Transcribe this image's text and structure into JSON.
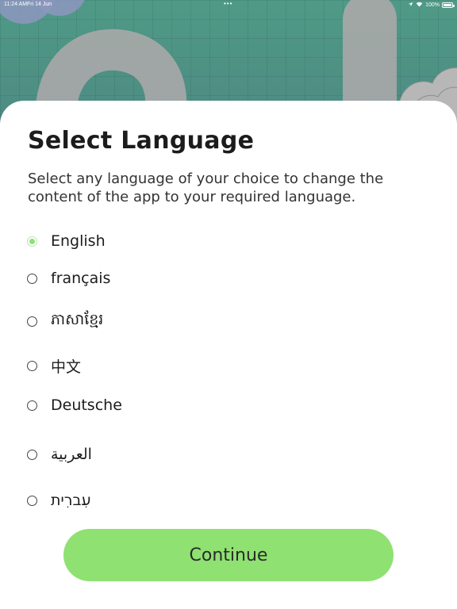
{
  "status_bar": {
    "time": "11:24 AM",
    "date": "Fri 14 Jun",
    "dots": "•••",
    "battery": "100%",
    "icons": [
      "location-arrow-icon",
      "wifi-icon",
      "battery-icon"
    ]
  },
  "sheet": {
    "title": "Select Language",
    "subtitle": "Select any language of your choice to change the content of the app to your required language."
  },
  "languages": [
    {
      "label": "English",
      "selected": true
    },
    {
      "label": "français",
      "selected": false
    },
    {
      "label": "ភាសាខ្មែរ",
      "selected": false
    },
    {
      "label": "中文",
      "selected": false
    },
    {
      "label": "Deutsche",
      "selected": false
    },
    {
      "label": "العربية",
      "selected": false
    },
    {
      "label": "עִברִית",
      "selected": false
    }
  ],
  "continue_button": {
    "label": "Continue"
  },
  "colors": {
    "accent": "#8fe172",
    "radio_selected": "#8fe07a",
    "sheet_bg": "#ffffff",
    "text": "#1c1c1c"
  }
}
